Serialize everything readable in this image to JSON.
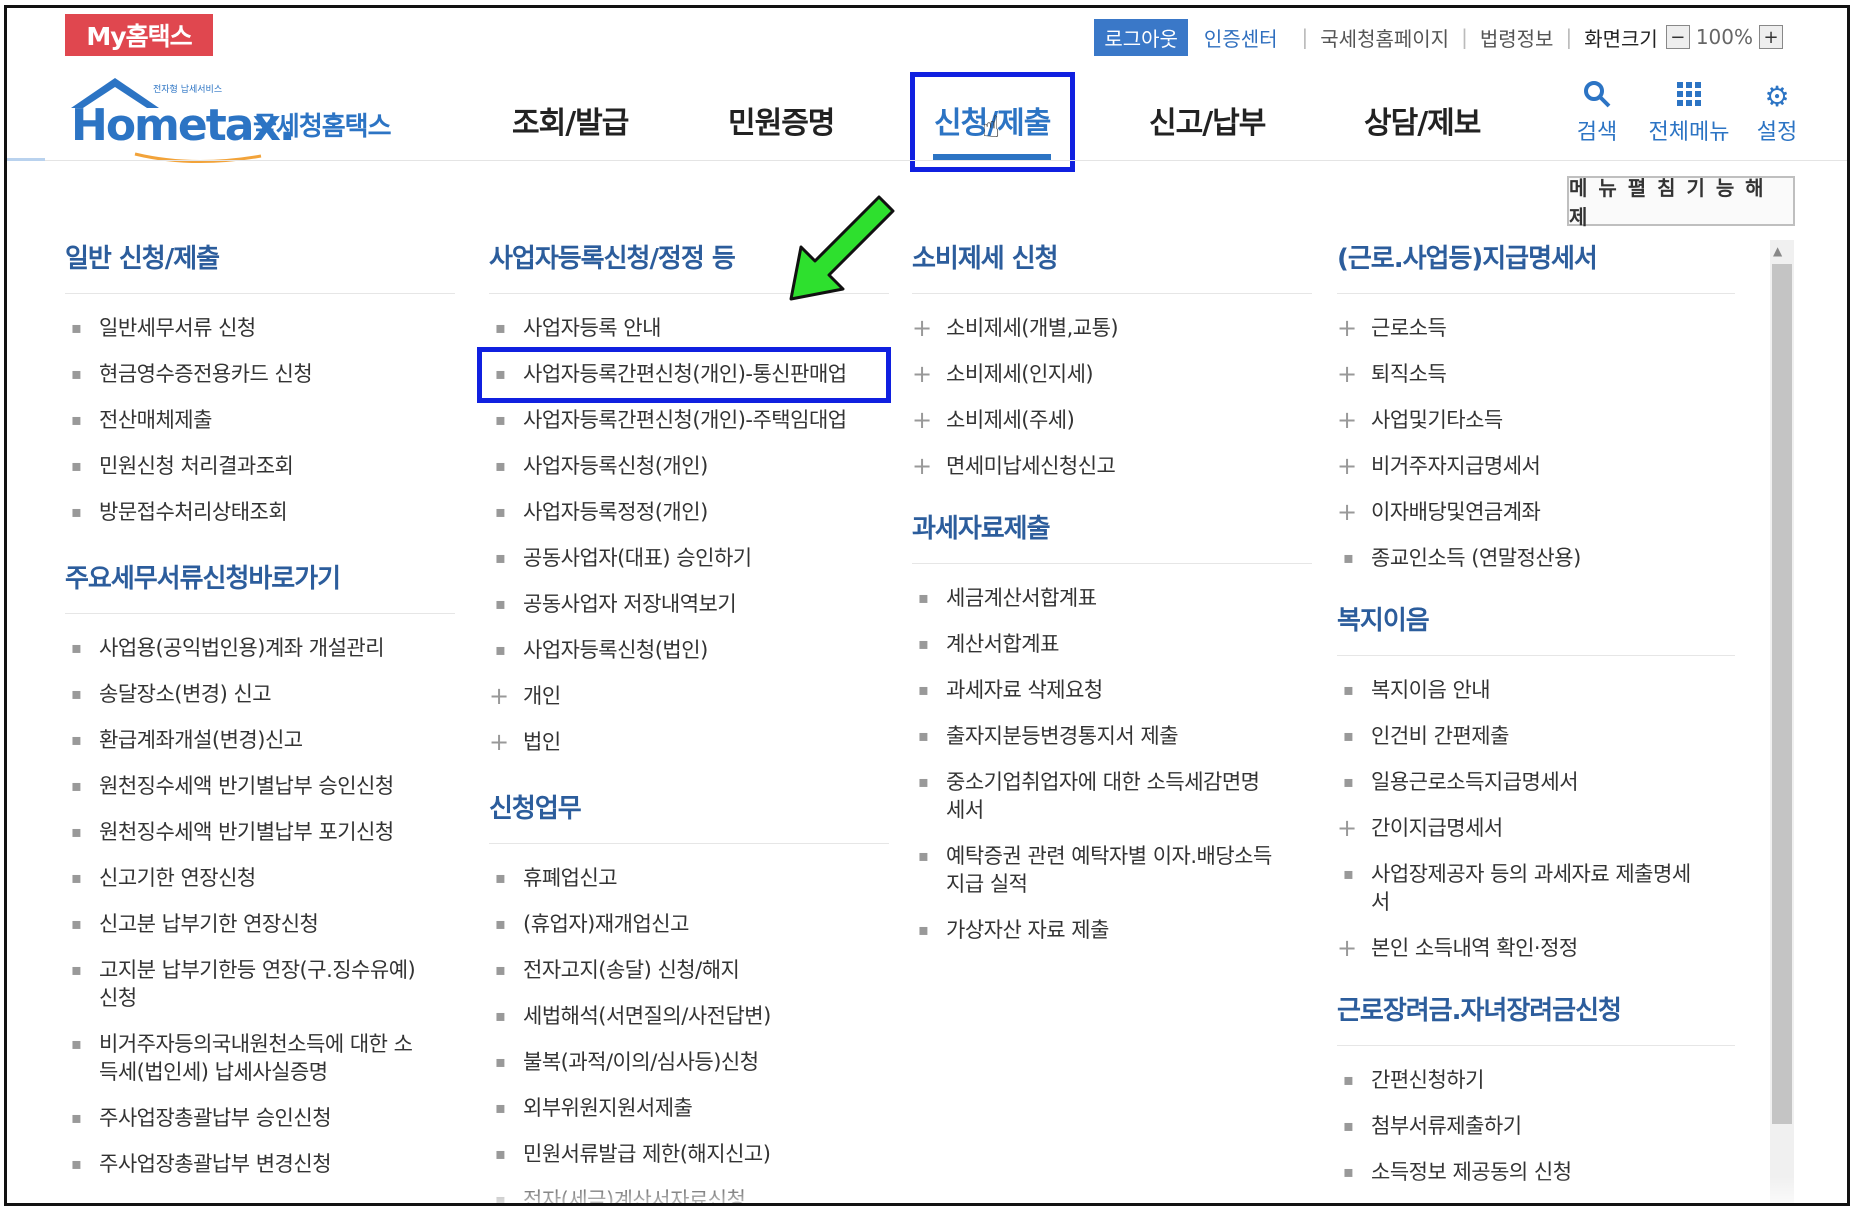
{
  "header": {
    "my_hometax": "My홈택스",
    "logout": "로그아웃",
    "cert_center": "인증센터",
    "util_links": [
      "국세청홈페이지",
      "법령정보"
    ],
    "screen_size": "화면크기",
    "zoom": "100%",
    "zoom_minus": "−",
    "zoom_plus": "+"
  },
  "logo": {
    "brand": "Hometax.",
    "korean": "국세청홈택스",
    "tagline": "전자형 납세서비스"
  },
  "nav": {
    "items": [
      "조회/발급",
      "민원증명",
      "신청/제출",
      "신고/납부",
      "상담/제보"
    ],
    "active": "신청/제출",
    "search": "검색",
    "all_menu": "전체메뉴",
    "settings": "설정"
  },
  "menu_fold_button": "메 뉴 펼 침  기 능 해 제",
  "columns": {
    "col1": {
      "sections": [
        {
          "title": "일반 신청/제출",
          "items": [
            "일반세무서류 신청",
            "현금영수증전용카드 신청",
            "전산매체제출",
            "민원신청 처리결과조회",
            "방문접수처리상태조회"
          ]
        },
        {
          "title": "주요세무서류신청바로가기",
          "items": [
            "사업용(공익법인용)계좌 개설관리",
            "송달장소(변경) 신고",
            "환급계좌개설(변경)신고",
            "원천징수세액 반기별납부 승인신청",
            "원천징수세액 반기별납부 포기신청",
            "신고기한 연장신청",
            "신고분 납부기한 연장신청",
            "고지분 납부기한등 연장(구.징수유예)\n신청",
            "비거주자등의국내원천소득에 대한 소\n득세(법인세) 납세사실증명",
            "주사업장총괄납부 승인신청",
            "주사업장총괄납부 변경신청"
          ]
        }
      ]
    },
    "col2": {
      "sections": [
        {
          "title": "사업자등록신청/정정 등",
          "items": [
            {
              "text": "사업자등록 안내",
              "type": "bullet"
            },
            {
              "text": "사업자등록간편신청(개인)-통신판매업",
              "type": "bullet"
            },
            {
              "text": "사업자등록간편신청(개인)-주택임대업",
              "type": "bullet"
            },
            {
              "text": "사업자등록신청(개인)",
              "type": "bullet"
            },
            {
              "text": "사업자등록정정(개인)",
              "type": "bullet"
            },
            {
              "text": "공동사업자(대표) 승인하기",
              "type": "bullet"
            },
            {
              "text": "공동사업자 저장내역보기",
              "type": "bullet"
            },
            {
              "text": "사업자등록신청(법인)",
              "type": "bullet"
            },
            {
              "text": "개인",
              "type": "plus"
            },
            {
              "text": "법인",
              "type": "plus"
            }
          ]
        },
        {
          "title": "신청업무",
          "items": [
            {
              "text": "휴폐업신고",
              "type": "bullet"
            },
            {
              "text": "(휴업자)재개업신고",
              "type": "bullet"
            },
            {
              "text": "전자고지(송달) 신청/해지",
              "type": "bullet"
            },
            {
              "text": "세법해석(서면질의/사전답변)",
              "type": "bullet"
            },
            {
              "text": "불복(과적/이의/심사등)신청",
              "type": "bullet"
            },
            {
              "text": "외부위원지원서제출",
              "type": "bullet"
            },
            {
              "text": "민원서류발급 제한(해지신고)",
              "type": "bullet"
            },
            {
              "text": "전자(세금)계산서자료신청",
              "type": "bullet"
            }
          ]
        }
      ]
    },
    "col3": {
      "sections": [
        {
          "title": "소비제세 신청",
          "items": [
            {
              "text": "소비제세(개별,교통)",
              "type": "plus"
            },
            {
              "text": "소비제세(인지세)",
              "type": "plus"
            },
            {
              "text": "소비제세(주세)",
              "type": "plus"
            },
            {
              "text": "면세미납세신청신고",
              "type": "plus"
            }
          ]
        },
        {
          "title": "과세자료제출",
          "items": [
            {
              "text": "세금계산서합계표",
              "type": "bullet"
            },
            {
              "text": "계산서합계표",
              "type": "bullet"
            },
            {
              "text": "과세자료 삭제요청",
              "type": "bullet"
            },
            {
              "text": "출자지분등변경통지서 제출",
              "type": "bullet"
            },
            {
              "text": "중소기업취업자에 대한 소득세감면명\n세서",
              "type": "bullet"
            },
            {
              "text": "예탁증권 관련 예탁자별 이자.배당소득\n지급 실적",
              "type": "bullet"
            },
            {
              "text": "가상자산 자료 제출",
              "type": "bullet"
            }
          ]
        }
      ]
    },
    "col4": {
      "sections": [
        {
          "title": "(근로.사업등)지급명세서",
          "items": [
            {
              "text": "근로소득",
              "type": "plus"
            },
            {
              "text": "퇴직소득",
              "type": "plus"
            },
            {
              "text": "사업및기타소득",
              "type": "plus"
            },
            {
              "text": "비거주자지급명세서",
              "type": "plus"
            },
            {
              "text": "이자배당및연금계좌",
              "type": "plus"
            },
            {
              "text": "종교인소득 (연말정산용)",
              "type": "bullet"
            }
          ]
        },
        {
          "title": "복지이음",
          "items": [
            {
              "text": "복지이음 안내",
              "type": "bullet"
            },
            {
              "text": "인건비 간편제출",
              "type": "bullet"
            },
            {
              "text": "일용근로소득지급명세서",
              "type": "bullet"
            },
            {
              "text": "간이지급명세서",
              "type": "plus"
            },
            {
              "text": "사업장제공자 등의 과세자료 제출명세\n서",
              "type": "bullet"
            },
            {
              "text": "본인 소득내역 확인·정정",
              "type": "plus"
            }
          ]
        },
        {
          "title": "근로장려금.자녀장려금신청",
          "items": [
            {
              "text": "간편신청하기",
              "type": "bullet"
            },
            {
              "text": "첨부서류제출하기",
              "type": "bullet"
            },
            {
              "text": "소득정보 제공동의 신청",
              "type": "bullet"
            }
          ]
        }
      ]
    }
  },
  "colors": {
    "brand_blue": "#2c74c4",
    "section_blue": "#2c5d9c",
    "highlight_box": "#1020e0",
    "my_hometax_red": "#e0474f",
    "arrow_green": "#2ee02e"
  }
}
